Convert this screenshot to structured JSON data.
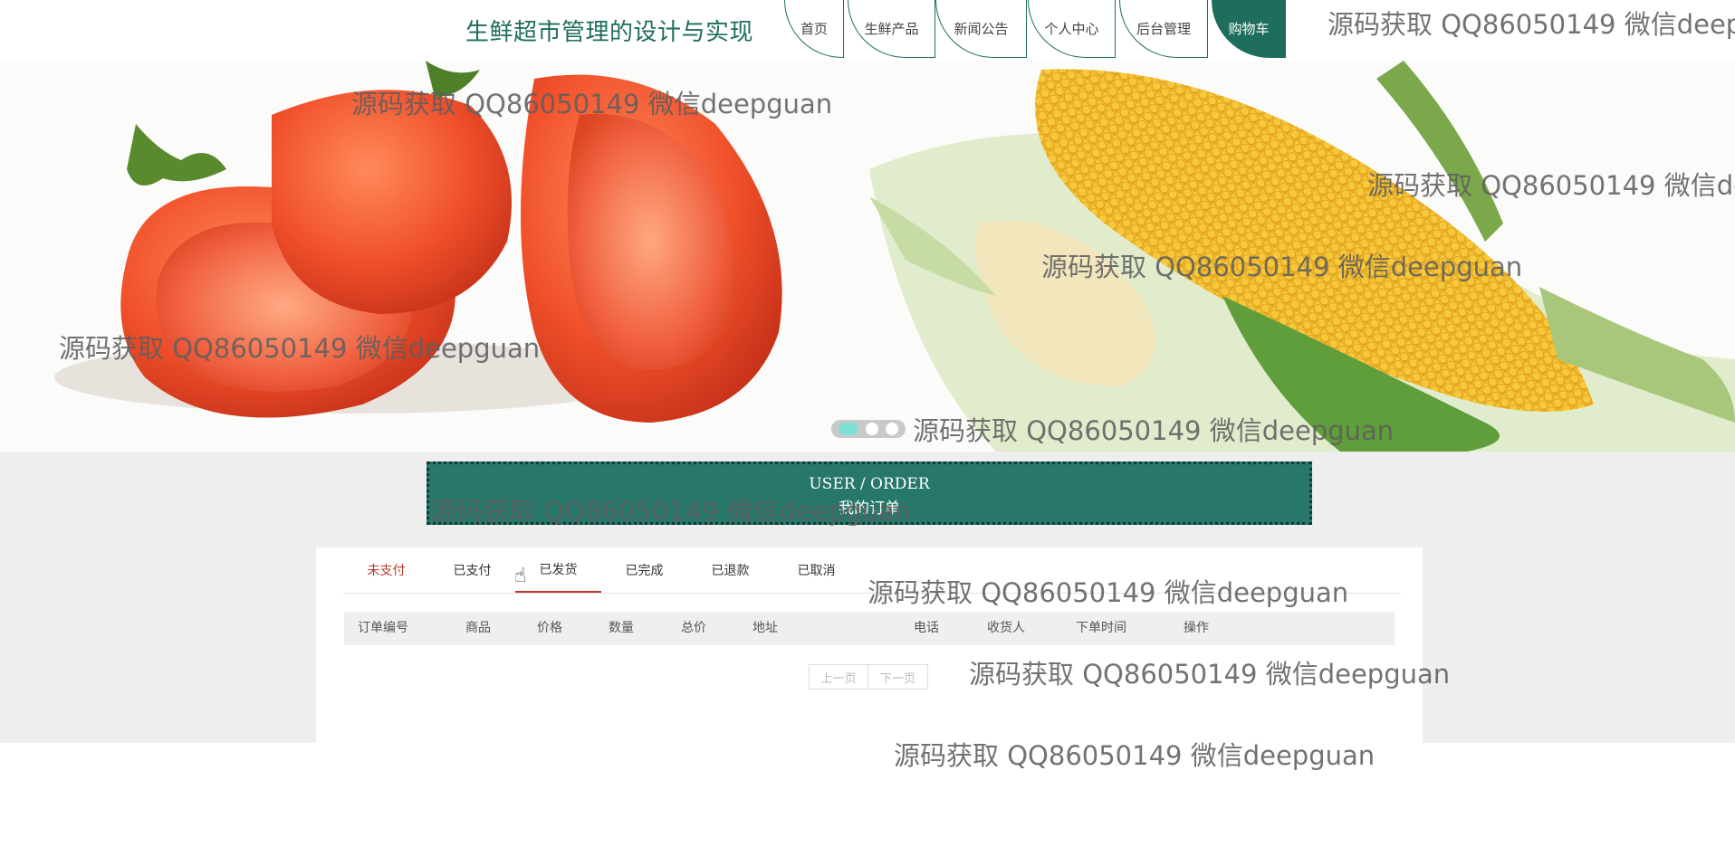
{
  "header": {
    "title": "生鲜超市管理的设计与实现",
    "nav": [
      {
        "label": "首页",
        "active": false
      },
      {
        "label": "生鲜产品",
        "active": false
      },
      {
        "label": "新闻公告",
        "active": false
      },
      {
        "label": "个人中心",
        "active": false
      },
      {
        "label": "后台管理",
        "active": false
      },
      {
        "label": "购物车",
        "active": true
      }
    ]
  },
  "banner": {
    "slides": 3,
    "active_slide": 1
  },
  "order_section": {
    "title_en": "USER / ORDER",
    "title_zh": "我的订单"
  },
  "tabs": [
    "未支付",
    "已支付",
    "已发货",
    "已完成",
    "已退款",
    "已取消"
  ],
  "active_tab": "未支付",
  "table": {
    "columns": [
      "订单编号",
      "商品",
      "价格",
      "数量",
      "总价",
      "地址",
      "电话",
      "收货人",
      "下单时间",
      "操作"
    ],
    "rows": []
  },
  "pager": {
    "prev": "上一页",
    "next": "下一页"
  },
  "watermark": "源码获取 QQ86050149 微信deepguan",
  "colors": {
    "brand": "#1e6d5d",
    "order_banner": "#27776a",
    "active_tab": "#c0392b"
  }
}
